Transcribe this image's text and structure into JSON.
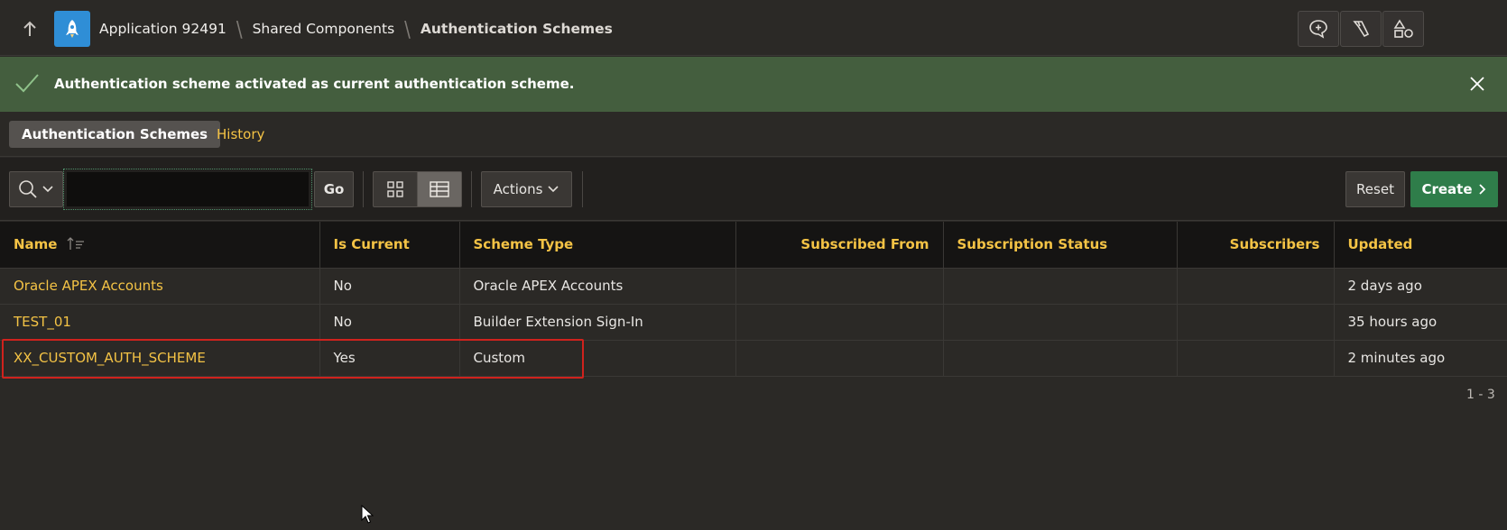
{
  "header": {
    "up_icon": "arrow-up-icon",
    "app_icon": "rocket-icon",
    "breadcrumbs": [
      "Application 92491",
      "Shared Components",
      "Authentication Schemes"
    ],
    "buttons": [
      "feedback-icon",
      "developer-tools-icon",
      "shapes-icon"
    ]
  },
  "alert": {
    "message": "Authentication scheme activated as current authentication scheme.",
    "color": "#445e3e"
  },
  "tabs": [
    {
      "label": "Authentication Schemes",
      "active": true
    },
    {
      "label": "History",
      "active": false
    }
  ],
  "toolbar": {
    "search_value": "",
    "go_label": "Go",
    "actions_label": "Actions",
    "reset_label": "Reset",
    "create_label": "Create"
  },
  "table": {
    "columns": [
      "Name",
      "Is Current",
      "Scheme Type",
      "Subscribed From",
      "Subscription Status",
      "Subscribers",
      "Updated"
    ],
    "rows": [
      [
        "Oracle APEX Accounts",
        "No",
        "Oracle APEX Accounts",
        "",
        "",
        "",
        "2 days ago"
      ],
      [
        "TEST_01",
        "No",
        "Builder Extension Sign-In",
        "",
        "",
        "",
        "35 hours ago"
      ],
      [
        "XX_CUSTOM_AUTH_SCHEME",
        "Yes",
        "Custom",
        "",
        "",
        "",
        "2 minutes ago"
      ]
    ]
  },
  "pagination": "1 - 3",
  "colors": {
    "accent_link": "#f4c345",
    "create_button": "#2f7d4a",
    "highlight_border": "#d0221d"
  }
}
